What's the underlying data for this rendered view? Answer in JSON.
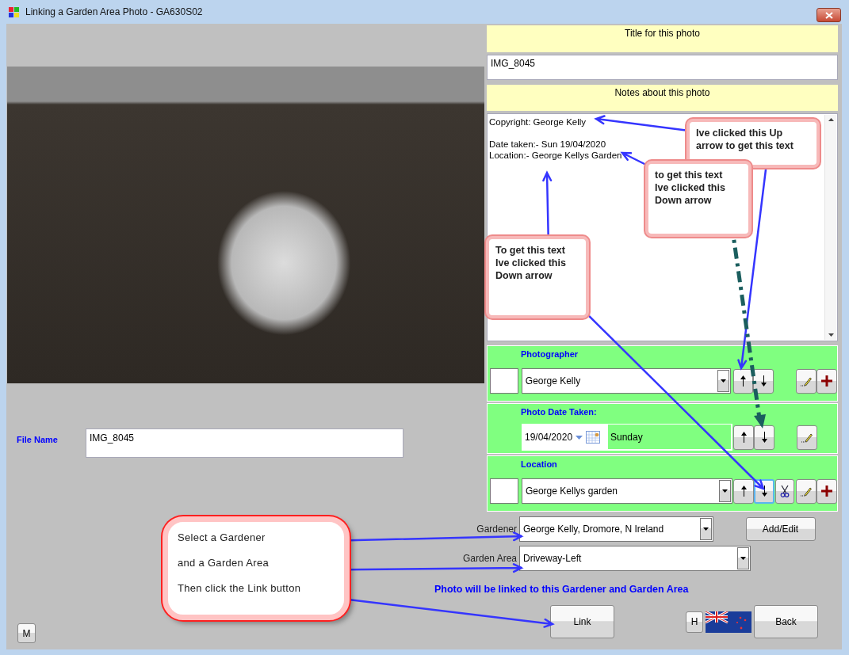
{
  "window": {
    "title": "Linking a Garden Area Photo -  GA630S02"
  },
  "photo_title": {
    "label": "Title for this photo",
    "value": "IMG_8045"
  },
  "notes": {
    "label": "Notes about this photo",
    "paragraphs": [
      [
        "Copyright: George Kelly"
      ],
      [
        "Date taken:- Sun 19/04/2020",
        "Location:- George Kellys Garden"
      ]
    ]
  },
  "photographer": {
    "label": "Photographer",
    "value": "George Kelly"
  },
  "date_taken": {
    "label": "Photo Date Taken:",
    "date": "19/04/2020",
    "day": "Sunday"
  },
  "location": {
    "label": "Location",
    "value": "George Kellys garden",
    "down_focused": true
  },
  "file_name": {
    "label": "File Name",
    "value": "IMG_8045"
  },
  "gardener": {
    "label": "Gardener",
    "value": "George Kelly, Dromore, N Ireland",
    "button": "Add/Edit"
  },
  "garden_area": {
    "label": "Garden Area",
    "value": "Driveway-Left"
  },
  "link_note": "Photo will be linked to this Gardener and Garden Area",
  "buttons": {
    "m": "M",
    "link": "Link",
    "h": "H",
    "back": "Back"
  },
  "callouts": [
    {
      "kind": "note",
      "paragraphs": [
        "Ive clicked this Up arrow to get this text"
      ]
    },
    {
      "kind": "note",
      "paragraphs": [
        "to get this text",
        "Ive clicked this Down arrow"
      ]
    },
    {
      "kind": "note",
      "paragraphs": [
        "To get this text",
        "Ive clicked this Down arrow"
      ]
    },
    {
      "kind": "bubble",
      "paragraphs": [
        "Select a Gardener",
        "and a Garden Area",
        "Then click the Link button"
      ]
    }
  ]
}
